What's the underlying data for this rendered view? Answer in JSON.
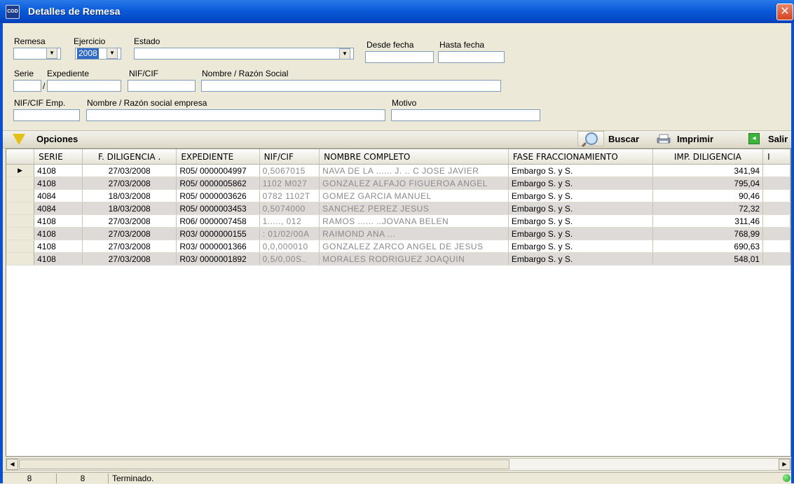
{
  "window": {
    "title": "Detalles de Remesa",
    "icon_text": "CGD",
    "close_symbol": "✕"
  },
  "filters": {
    "remesa": {
      "label": "Remesa",
      "value": ""
    },
    "ejercicio": {
      "label": "Ejercicio",
      "value": "2008"
    },
    "estado": {
      "label": "Estado",
      "value": ""
    },
    "desde_fecha": {
      "label": "Desde fecha",
      "value": ""
    },
    "hasta_fecha": {
      "label": "Hasta fecha",
      "value": ""
    },
    "serie": {
      "label": "Serie",
      "value": ""
    },
    "expediente": {
      "label": "Expediente",
      "separator": "/",
      "value": ""
    },
    "nif_cif": {
      "label": "NIF/CIF",
      "value": ""
    },
    "nombre": {
      "label": "Nombre / Razón Social",
      "value": ""
    },
    "nif_cif_emp": {
      "label": "NIF/CIF Emp.",
      "value": ""
    },
    "nombre_empresa": {
      "label": "Nombre / Razón social empresa",
      "value": ""
    },
    "motivo": {
      "label": "Motivo",
      "value": ""
    }
  },
  "toolbar": {
    "options_label": "Opciones",
    "search_label": "Buscar",
    "print_label": "Imprimir",
    "exit_label": "Salir"
  },
  "grid": {
    "columns": [
      "SERIE",
      "F. DILIGENCIA .",
      "EXPEDIENTE",
      "NIF/CIF",
      "NOMBRE COMPLETO",
      "FASE FRACCIONAMIENTO",
      "IMP. DILIGENCIA",
      "I"
    ],
    "rows": [
      {
        "serie": "4108",
        "fecha": "27/03/2008",
        "expediente": "R05/ 0000004997",
        "nif": "0,5067015",
        "nombre": "NAVA DE LA ...... J. .. C JOSE JAVIER",
        "fase": "Embargo S. y S.",
        "importe": "341,94"
      },
      {
        "serie": "4108",
        "fecha": "27/03/2008",
        "expediente": "R05/ 0000005862",
        "nif": "1102 M027",
        "nombre": "GONZALEZ ALFAJO FIGUEROA ANGEL",
        "fase": "Embargo S. y S.",
        "importe": "795,04"
      },
      {
        "serie": "4084",
        "fecha": "18/03/2008",
        "expediente": "R05/ 0000003626",
        "nif": "0782 1102T",
        "nombre": "GOMEZ GARCIA MANUEL",
        "fase": "Embargo S. y S.",
        "importe": "90,46"
      },
      {
        "serie": "4084",
        "fecha": "18/03/2008",
        "expediente": "R05/ 0000003453",
        "nif": "0,5074000",
        "nombre": "SANCHEZ PEREZ JESUS",
        "fase": "Embargo S. y S.",
        "importe": "72,32"
      },
      {
        "serie": "4108",
        "fecha": "27/03/2008",
        "expediente": "R06/ 0000007458",
        "nif": "1....., 012",
        "nombre": "RAMOS ......  ..JOVANA BELEN",
        "fase": "Embargo S. y S.",
        "importe": "311,46"
      },
      {
        "serie": "4108",
        "fecha": "27/03/2008",
        "expediente": "R03/ 0000000155",
        "nif": ": 01/02/00A",
        "nombre": "RAIMOND ANA ...",
        "fase": "Embargo S. y S.",
        "importe": "768,99"
      },
      {
        "serie": "4108",
        "fecha": "27/03/2008",
        "expediente": "R03/ 0000001366",
        "nif": "0,0,000010",
        "nombre": "GONZALEZ ZARCO ANGEL DE JESUS",
        "fase": "Embargo S. y S.",
        "importe": "690,63"
      },
      {
        "serie": "4108",
        "fecha": "27/03/2008",
        "expediente": "R03/ 0000001892",
        "nif": "0,5/0,00S..",
        "nombre": "MORALES RODRIGUEZ JOAQUIN",
        "fase": "Embargo S. y S.",
        "importe": "548,01"
      }
    ]
  },
  "status": {
    "count1": "8",
    "count2": "8",
    "message": "Terminado."
  }
}
